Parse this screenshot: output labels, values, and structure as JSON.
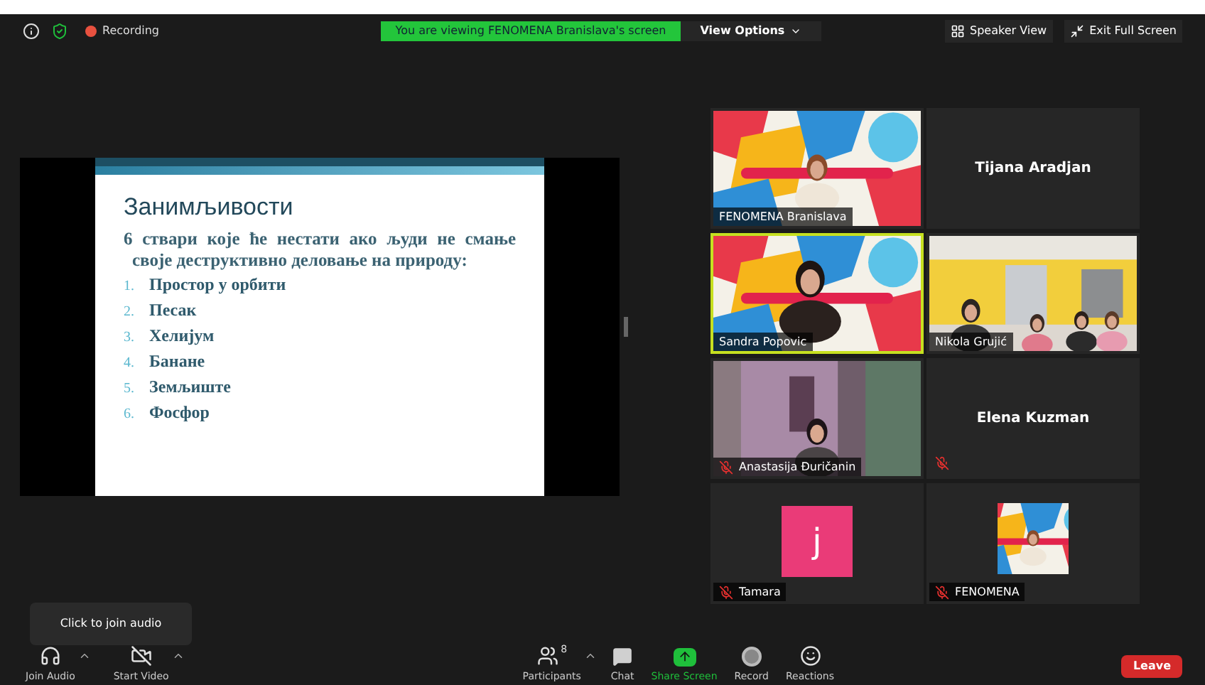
{
  "top_bar": {
    "recording": "Recording",
    "banner": "You are viewing FENOMENA Branislava's screen",
    "view_options": "View Options",
    "speaker_view": "Speaker View",
    "exit_full_screen": "Exit Full Screen"
  },
  "slide": {
    "title": "Занимљивости",
    "intro": "6 ствари које ће нестати ако људи не смање своје деструктивно деловање на природу:",
    "items": [
      {
        "number": "1.",
        "text": "Простор у орбити"
      },
      {
        "number": "2.",
        "text": "Песак"
      },
      {
        "number": "3.",
        "text": "Хелијум"
      },
      {
        "number": "4.",
        "text": "Банане"
      },
      {
        "number": "5.",
        "text": "Земљиште"
      },
      {
        "number": "6.",
        "text": "Фосфор"
      }
    ]
  },
  "participants": [
    {
      "name": "FENOMENA Branislava",
      "kind": "picture",
      "muted": false,
      "active": false
    },
    {
      "name": "Tijana Aradjan",
      "kind": "name_only",
      "muted": false,
      "active": false
    },
    {
      "name": "Sandra Popovic",
      "kind": "picture",
      "muted": false,
      "active": true
    },
    {
      "name": "Nikola Grujić",
      "kind": "picture",
      "muted": false,
      "active": false
    },
    {
      "name": "Anastasija Đuričanin",
      "kind": "picture",
      "muted": true,
      "active": false
    },
    {
      "name": "Elena Kuzman",
      "kind": "name_only",
      "muted": true,
      "active": false
    },
    {
      "name": "Tamara",
      "kind": "avatar",
      "letter": "j",
      "muted": true,
      "active": false
    },
    {
      "name": "FENOMENA",
      "kind": "logo",
      "muted": true,
      "active": false
    }
  ],
  "tooltip": "Click to join audio",
  "toolbar": [
    {
      "kind": "audio",
      "label": "Join Audio",
      "caret": true
    },
    {
      "kind": "video",
      "label": "Start Video",
      "caret": true
    },
    {
      "kind": "participants",
      "label": "Participants",
      "count": "8",
      "caret": true
    },
    {
      "kind": "chat",
      "label": "Chat",
      "caret": false
    },
    {
      "kind": "share",
      "label": "Share Screen",
      "caret": false
    },
    {
      "kind": "record",
      "label": "Record",
      "caret": false
    },
    {
      "kind": "reactions",
      "label": "Reactions",
      "caret": false
    }
  ],
  "leave": "Leave"
}
